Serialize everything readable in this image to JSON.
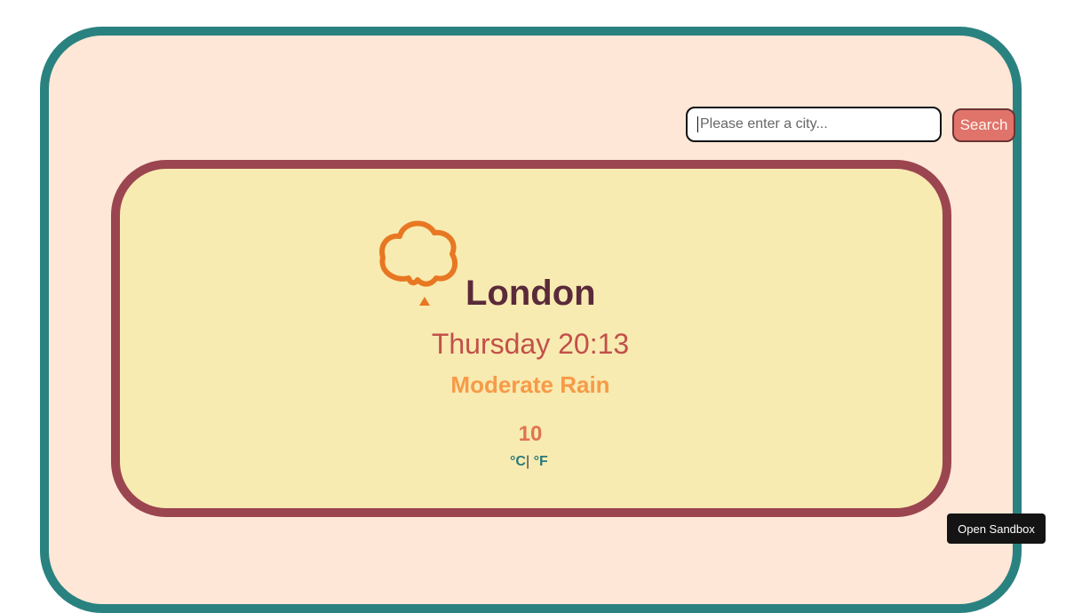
{
  "search": {
    "placeholder": "Please enter a city...",
    "value": "",
    "button_label": "Search"
  },
  "weather": {
    "city": "London",
    "date_time": "Thursday 20:13",
    "condition": "Moderate Rain",
    "temperature": "10",
    "unit_celsius": "°C",
    "unit_separator": "|",
    "unit_fahrenheit": "°F",
    "icon": "cloud-rain-icon"
  },
  "sandbox": {
    "button_label": "Open Sandbox"
  },
  "colors": {
    "frame_border": "#2a8280",
    "frame_background": "#fee7d7",
    "card_border": "#9b4550",
    "card_background": "#f8ebb1",
    "icon": "#e87722",
    "city": "#5a2a3a",
    "date_time": "#c2504a",
    "condition": "#f79a47",
    "temperature": "#e0744f",
    "units": "#2a7a7a",
    "search_button": "#e0736a"
  }
}
